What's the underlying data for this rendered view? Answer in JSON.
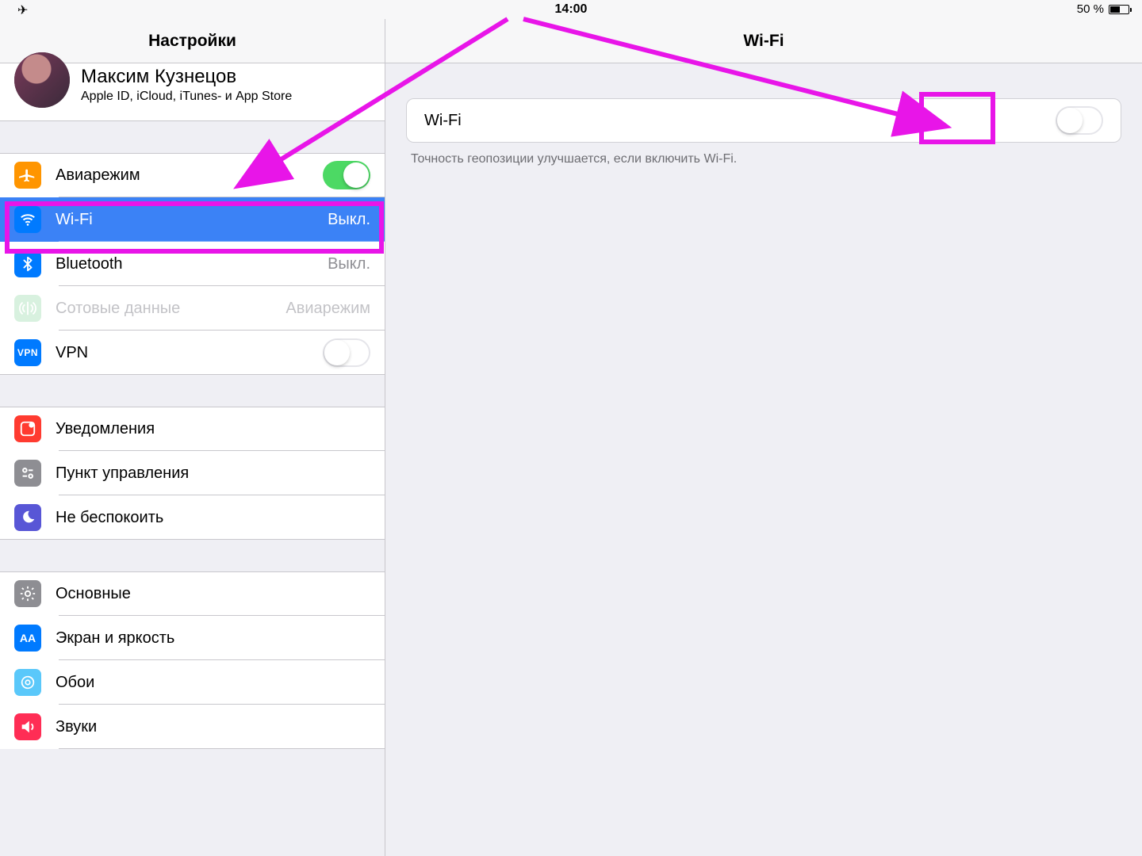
{
  "statusbar": {
    "time": "14:00",
    "battery_text": "50 %"
  },
  "sidebar": {
    "title": "Настройки",
    "account_name": "Максим Кузнецов",
    "account_sub": "Apple ID, iCloud, iTunes- и App Store",
    "rows": {
      "airplane": "Авиарежим",
      "wifi": "Wi-Fi",
      "wifi_value": "Выкл.",
      "bluetooth": "Bluetooth",
      "bluetooth_value": "Выкл.",
      "cellular": "Сотовые данные",
      "cellular_value": "Авиарежим",
      "vpn": "VPN",
      "notifications": "Уведомления",
      "controlcenter": "Пункт управления",
      "dnd": "Не беспокоить",
      "general": "Основные",
      "display": "Экран и яркость",
      "wallpaper": "Обои",
      "sounds": "Звуки"
    }
  },
  "detail": {
    "title": "Wi-Fi",
    "wifi_label": "Wi-Fi",
    "footer": "Точность геопозиции улучшается, если включить Wi-Fi."
  }
}
